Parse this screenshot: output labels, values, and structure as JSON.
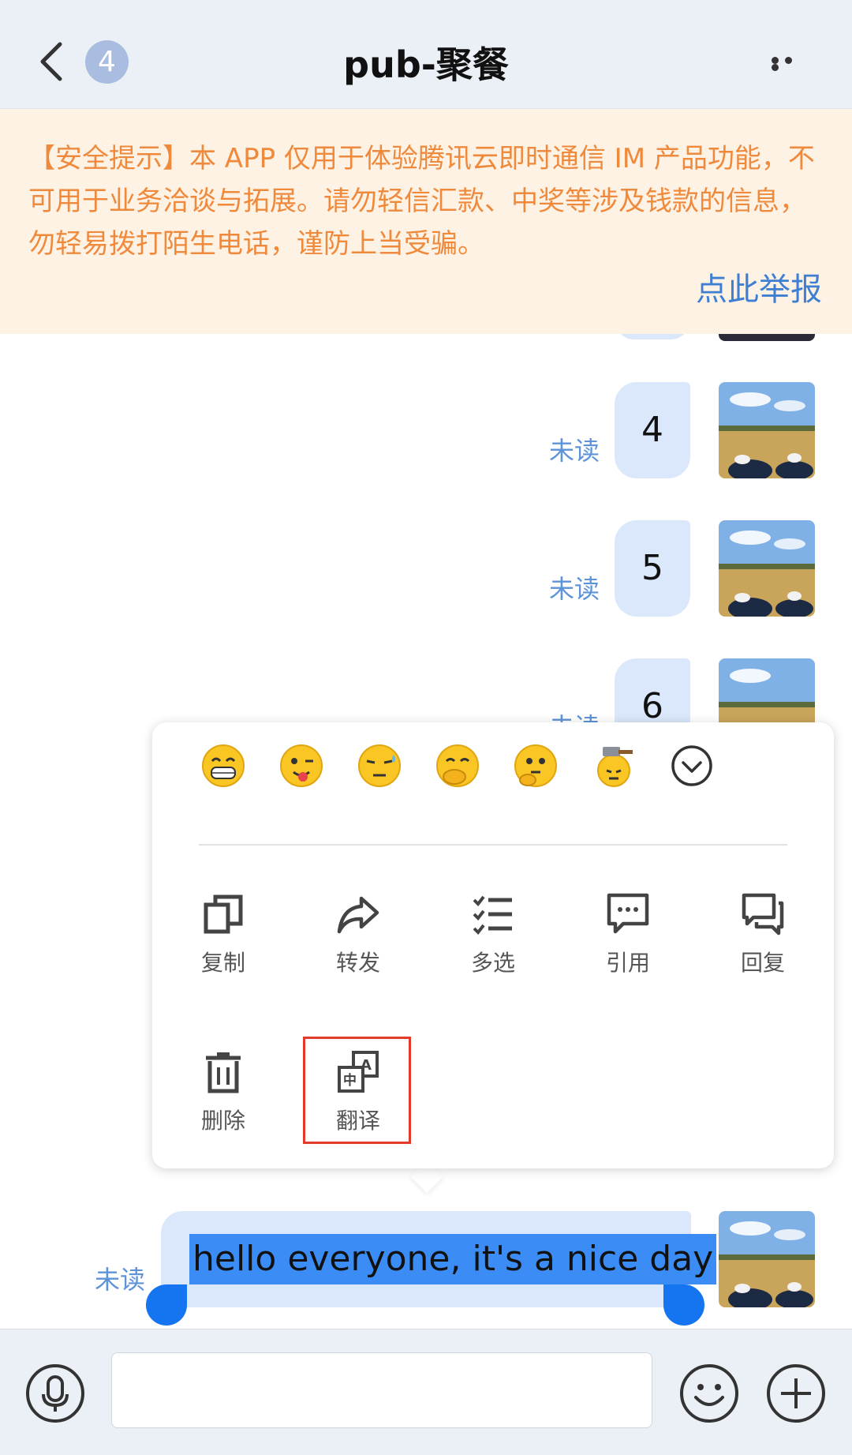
{
  "header": {
    "unread_count": "4",
    "title": "pub-聚餐"
  },
  "banner": {
    "text": "【安全提示】本 APP 仅用于体验腾讯云即时通信 IM 产品功能，不可用于业务洽谈与拓展。请勿轻信汇款、中奖等涉及钱款的信息，勿轻易拨打陌生电话，谨防上当受骗。",
    "report_link": "点此举报"
  },
  "messages": [
    {
      "text": "4",
      "status": "未读"
    },
    {
      "text": "5",
      "status": "未读"
    },
    {
      "text": "6",
      "status": "未读"
    }
  ],
  "selected_message": {
    "text": "hello everyone, it's a nice day",
    "status": "未读"
  },
  "popup": {
    "emojis": [
      "grin-emoji",
      "tongue-wink-emoji",
      "sweat-emoji",
      "covered-laugh-emoji",
      "thinking-emoji",
      "hammer-emoji"
    ],
    "actions": [
      {
        "label": "复制",
        "icon": "copy-icon"
      },
      {
        "label": "转发",
        "icon": "forward-icon"
      },
      {
        "label": "多选",
        "icon": "multi-select-icon"
      },
      {
        "label": "引用",
        "icon": "quote-icon"
      },
      {
        "label": "回复",
        "icon": "reply-icon"
      },
      {
        "label": "删除",
        "icon": "delete-icon"
      },
      {
        "label": "翻译",
        "icon": "translate-icon"
      }
    ]
  },
  "input": {
    "placeholder": "",
    "value": ""
  },
  "colors": {
    "header_bg": "#ebf0f6",
    "banner_bg": "#fdf2e4",
    "banner_text": "#ef8a3d",
    "link": "#3f7fd2",
    "bubble": "#dbe8fb",
    "unread": "#5d93d8",
    "selection": "#3b8cf5",
    "highlight_border": "#e33a2a"
  }
}
